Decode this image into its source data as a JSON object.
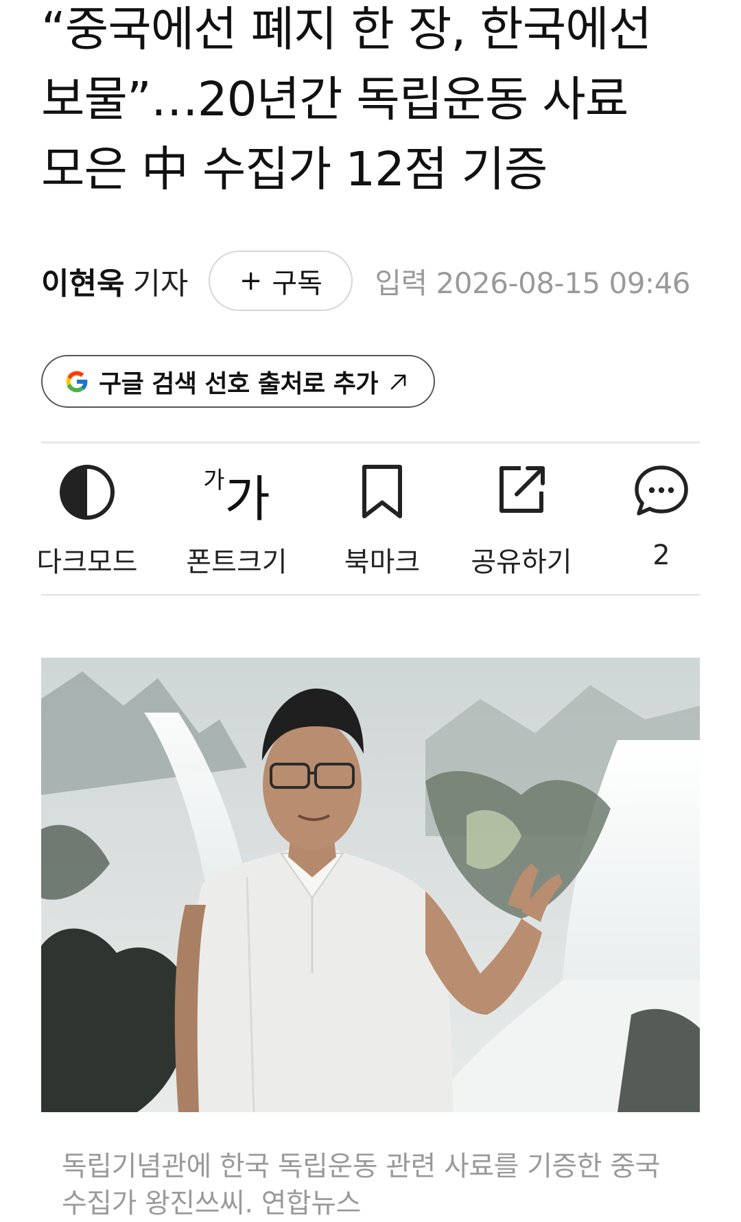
{
  "article": {
    "headline": "“중국에선 폐지 한 장, 한국에선 보물”…20년간 독립운동 사료 모은 中 수집가 12점 기증",
    "author_name": "이현욱",
    "author_role": "기자",
    "subscribe_plus": "+",
    "subscribe_label": "구독",
    "published": "입력 2026-08-15 09:46"
  },
  "google_source": {
    "label": "구글 검색 선호 출처로 추가",
    "icon": "google-g-icon",
    "arrow_icon": "external-arrow-icon"
  },
  "toolbar": {
    "dark_mode": {
      "label": "다크모드",
      "icon": "contrast-icon"
    },
    "font_size": {
      "label": "폰트크기",
      "icon_small": "가",
      "icon_big": "가"
    },
    "bookmark": {
      "label": "북마크",
      "icon": "bookmark-icon"
    },
    "share": {
      "label": "공유하기",
      "icon": "share-icon"
    },
    "comments": {
      "count": "2",
      "icon": "comment-icon"
    }
  },
  "photo": {
    "caption": "독립기념관에 한국 독립운동 관련 사료를 기증한 중국 수집가 왕진쓰씨. 연합뉴스"
  }
}
